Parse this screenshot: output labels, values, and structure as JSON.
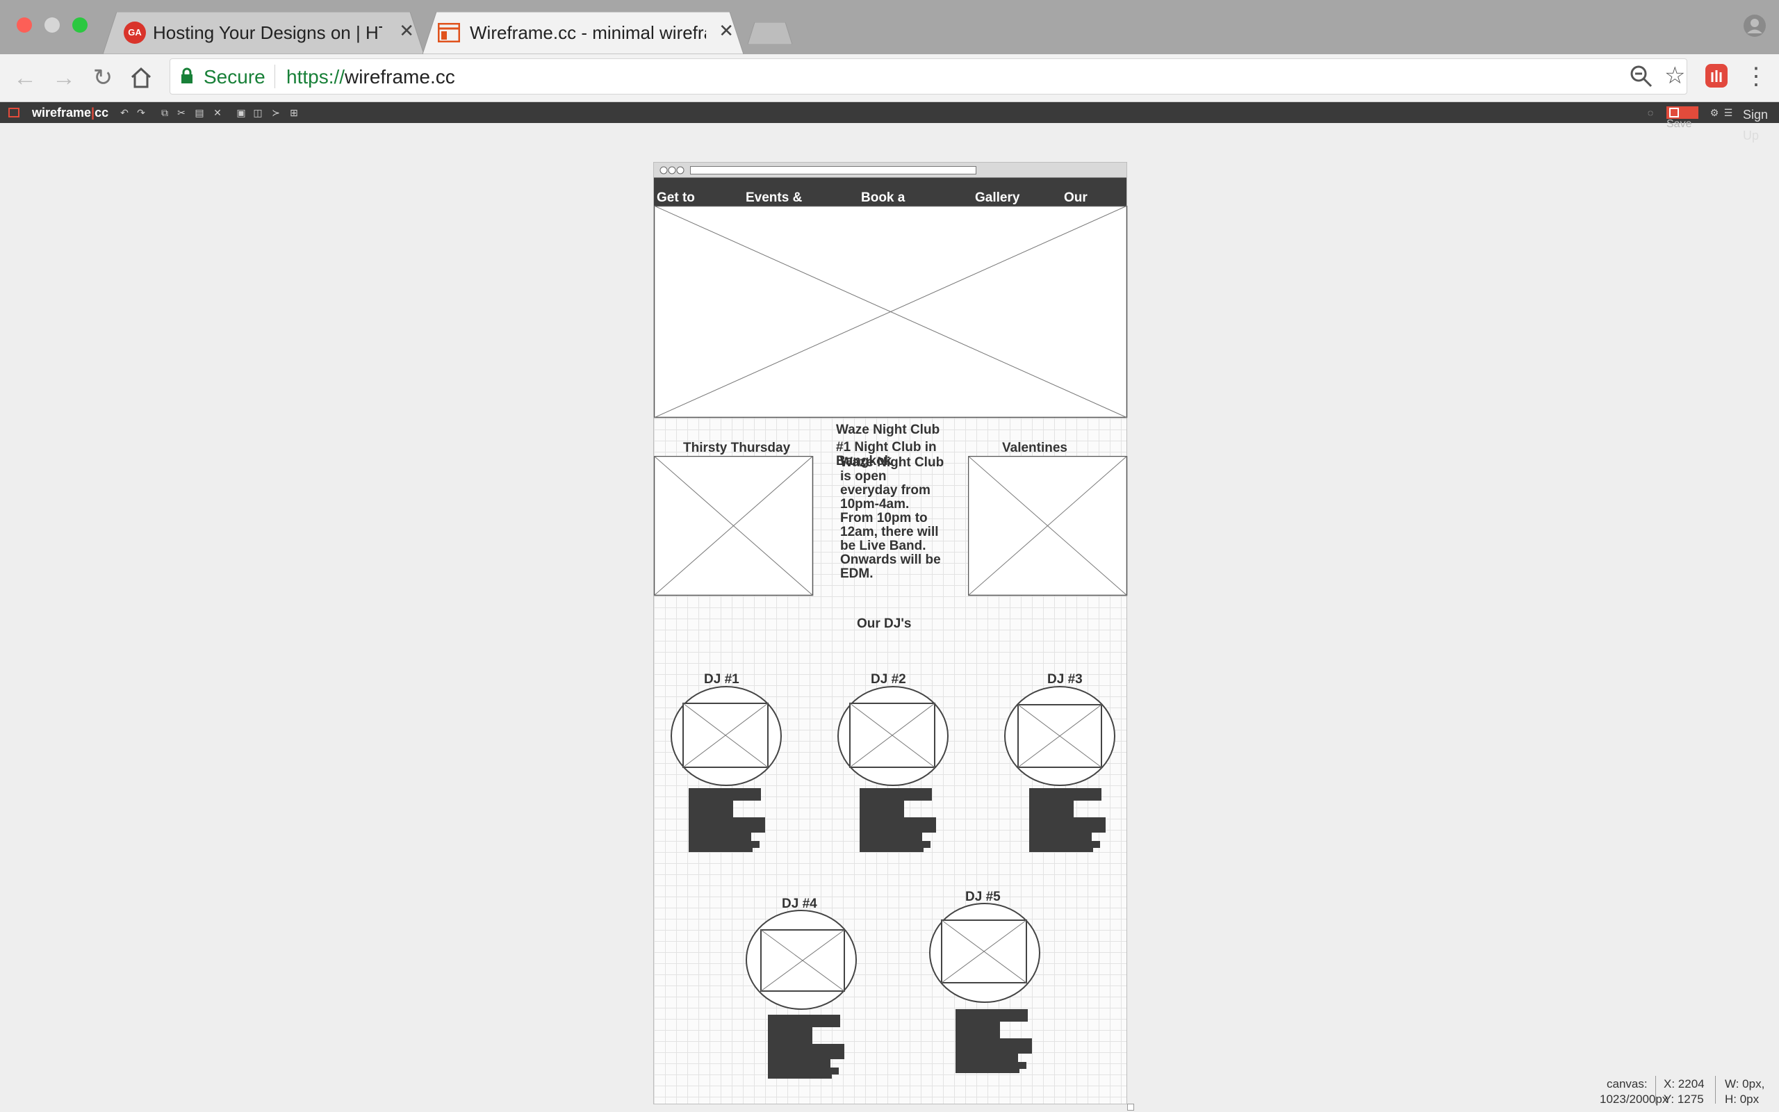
{
  "browser": {
    "tabs": [
      {
        "title": "Hosting Your Designs on | HTM",
        "favicon_text": "GA",
        "active": false
      },
      {
        "title": "Wireframe.cc - minimal wirefra",
        "active": true
      }
    ],
    "secure_label": "Secure",
    "url_scheme": "https://",
    "url_host": "wireframe.cc"
  },
  "app": {
    "logo_left": "wireframe",
    "logo_right": "cc",
    "save_label": "Save",
    "signup_label": "Sign Up"
  },
  "wireframe": {
    "nav": [
      "Get to",
      "Events &",
      "Book a",
      "Gallery",
      "Our"
    ],
    "club_title": "Waze Night Club",
    "club_subtitle": "#1 Night Club in Bangkok",
    "club_body": "Waze Night Club is open everyday from 10pm-4am. From 10pm to 12am, there will be Live Band. Onwards will be EDM.",
    "event_left": "Thirsty Thursday",
    "event_right": "Valentines",
    "djs_heading": "Our DJ's",
    "djs": [
      "DJ #1",
      "DJ #2",
      "DJ #3",
      "DJ #4",
      "DJ #5"
    ]
  },
  "status": {
    "canvas_label": "canvas:",
    "canvas_size": "1023/2000px",
    "x_label": "X: 2204",
    "y_label": "Y: 1275",
    "w_label": "W: 0px,",
    "h_label": "H: 0px"
  },
  "colors": {
    "tabbar": "#a6a6a6",
    "secure_green": "#188038",
    "appbar": "#3a3a3a",
    "wire_dark": "#3d3d3d"
  }
}
